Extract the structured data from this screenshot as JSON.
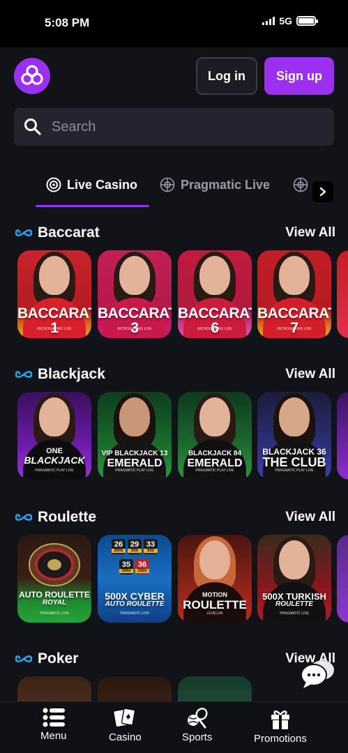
{
  "status_bar": {
    "time": "5:08 PM",
    "network": "5G"
  },
  "header": {
    "login_label": "Log in",
    "signup_label": "Sign up",
    "accent": "#9b30f0"
  },
  "search": {
    "placeholder": "Search"
  },
  "tabs": [
    {
      "label": "Live Casino",
      "active": true
    },
    {
      "label": "Pragmatic Live",
      "active": false
    }
  ],
  "sections": [
    {
      "title": "Baccarat",
      "view_all": "View All",
      "games": [
        {
          "name": "BACCARAT 1",
          "provider": "MICROGAMING LIVE"
        },
        {
          "name": "BACCARAT 3",
          "provider": "MICROGAMING LIVE"
        },
        {
          "name": "BACCARAT 6",
          "provider": "MICROGAMING LIVE"
        },
        {
          "name": "BACCARAT 7",
          "provider": "MICROGAMING LIVE"
        }
      ]
    },
    {
      "title": "Blackjack",
      "view_all": "View All",
      "games": [
        {
          "name_top": "ONE",
          "name": "BLACKJACK",
          "provider": "PRAGMATIC PLAY LIVE"
        },
        {
          "name_top": "VIP BLACKJACK 13",
          "name": "EMERALD",
          "provider": "PRAGMATIC PLAY LIVE"
        },
        {
          "name_top": "BLACKJACK 84",
          "name": "EMERALD",
          "provider": "PRAGMATIC PLAY LIVE"
        },
        {
          "name_top": "BLACKJACK 36",
          "name": "THE CLUB",
          "provider": "PRAGMATIC PLAY LIVE"
        }
      ]
    },
    {
      "title": "Roulette",
      "view_all": "View All",
      "games": [
        {
          "name_top": "AUTO ROULETTE",
          "name": "ROYAL",
          "provider": "PRAGMATIC LIVE"
        },
        {
          "name_top": "500X CYBER",
          "name": "AUTO ROULETTE",
          "provider": "PRAGMATIC LIVE",
          "numbers": [
            "26",
            "29",
            "33",
            "35",
            "36"
          ],
          "multipliers": [
            "200x",
            "50x",
            "50x",
            "100x",
            "250x"
          ]
        },
        {
          "name_top": "MOTION",
          "name": "ROULETTE",
          "provider": "LEVELON"
        },
        {
          "name_top": "500X TURKISH",
          "name": "ROULETTE",
          "provider": "PRAGMATIC LIVE"
        }
      ]
    },
    {
      "title": "Poker",
      "view_all": "View All"
    }
  ],
  "bottom_nav": [
    {
      "label": "Menu",
      "icon": "menu-icon"
    },
    {
      "label": "Casino",
      "icon": "cards-icon"
    },
    {
      "label": "Sports",
      "icon": "sports-icon"
    },
    {
      "label": "Promotions",
      "icon": "gift-icon"
    }
  ]
}
